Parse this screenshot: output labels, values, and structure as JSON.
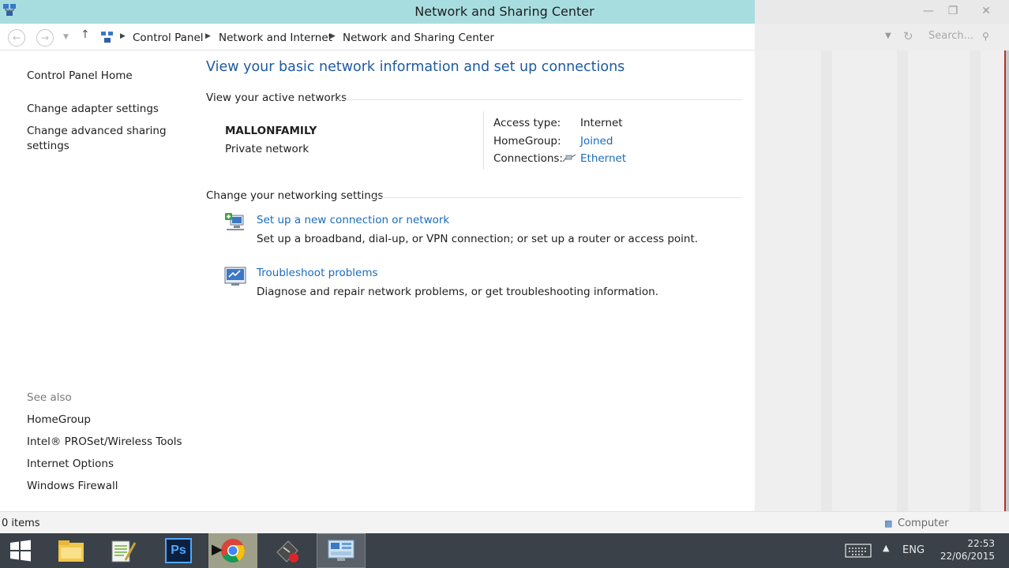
{
  "window": {
    "title": "Network and Sharing Center"
  },
  "address_bar": {
    "breadcrumbs": [
      "Control Panel",
      "Network and Internet",
      "Network and Sharing Center"
    ],
    "search_placeholder": "Search..."
  },
  "left_pane": {
    "links": [
      "Control Panel Home",
      "Change adapter settings",
      "Change advanced sharing",
      "settings"
    ],
    "see_also_label": "See also",
    "see_also": [
      "HomeGroup",
      "Intel® PROSet/Wireless Tools",
      "Internet Options",
      "Windows Firewall"
    ]
  },
  "main": {
    "title": "View your basic network information and set up connections",
    "active_networks_heading": "View your active networks",
    "network": {
      "name": "MALLONFAMILY",
      "type": "Private network"
    },
    "details": {
      "access_type_label": "Access type:",
      "access_type_value": "Internet",
      "homegroup_label": "HomeGroup:",
      "homegroup_value": "Joined",
      "connections_label": "Connections:",
      "connections_value": "Ethernet"
    },
    "change_heading": "Change your networking settings",
    "tasks": [
      {
        "link": "Set up a new connection or network",
        "description": "Set up a broadband, dial-up, or VPN connection; or set up a router or access point."
      },
      {
        "link": "Troubleshoot problems",
        "description": "Diagnose and repair network problems, or get troubleshooting information."
      }
    ]
  },
  "status_bar": {
    "items_count": "0 items",
    "location": "Computer"
  },
  "taskbar": {
    "apps": [
      "start-icon",
      "file-explorer-icon",
      "notepad-icon",
      "photoshop-icon",
      "chrome-icon",
      "recorder-icon",
      "control-panel-icon"
    ],
    "photoshop_label": "Ps",
    "language": "ENG",
    "time": "22:53",
    "date": "22/06/2015"
  },
  "colors": {
    "titlebar": "#a8dde0",
    "link": "#1a6bbd",
    "heading": "#1e5aa0",
    "taskbar": "#3a4148"
  }
}
